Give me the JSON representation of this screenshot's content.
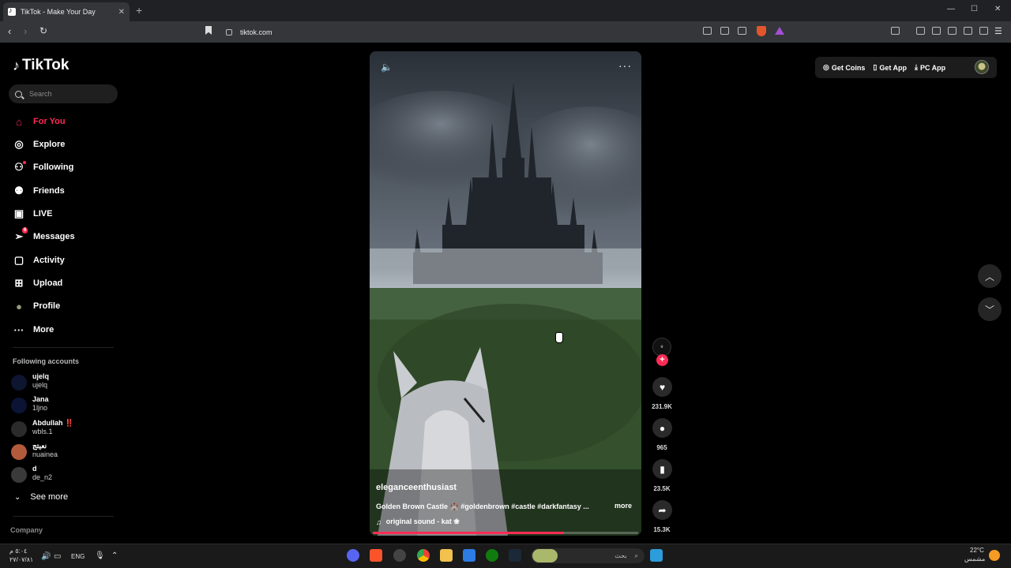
{
  "browser": {
    "tab_title": "TikTok - Make Your Day",
    "tab_close": "✕",
    "new_tab": "+",
    "url": "tiktok.com",
    "win_min": "—",
    "win_max": "☐",
    "win_close": "✕"
  },
  "sidebar": {
    "logo": "TikTok",
    "search_placeholder": "Search",
    "nav": [
      {
        "label": "For You",
        "icon": "home-icon",
        "glyph": "⌂"
      },
      {
        "label": "Explore",
        "icon": "compass-icon",
        "glyph": "◎"
      },
      {
        "label": "Following",
        "icon": "following-icon",
        "glyph": "⚇"
      },
      {
        "label": "Friends",
        "icon": "friends-icon",
        "glyph": "⚉"
      },
      {
        "label": "LIVE",
        "icon": "live-icon",
        "glyph": "▣"
      },
      {
        "label": "Messages",
        "icon": "messages-icon",
        "glyph": "➢",
        "badge": "6"
      },
      {
        "label": "Activity",
        "icon": "activity-icon",
        "glyph": "▢"
      },
      {
        "label": "Upload",
        "icon": "upload-icon",
        "glyph": "⊞"
      },
      {
        "label": "Profile",
        "icon": "profile-icon",
        "glyph": "●"
      },
      {
        "label": "More",
        "icon": "more-icon",
        "glyph": "···"
      }
    ],
    "following_title": "Following accounts",
    "accounts": [
      {
        "name": "ujelq",
        "handle": "ujelq"
      },
      {
        "name": "Jana",
        "handle": "1ljno"
      },
      {
        "name": "Abdullah ‼️",
        "handle": "wbls.1"
      },
      {
        "name": "نعيتج",
        "handle": "nuainea"
      },
      {
        "name": "d",
        "handle": "de_n2"
      }
    ],
    "see_more": "See more",
    "company": "Company"
  },
  "video": {
    "username": "eleganceenthusiast",
    "description": "Golden Brown Castle 🏰 #goldenbrown #castle #darkfantasy ...",
    "description_more": "more",
    "sound": "original sound - kat ❀",
    "progress": 0.72,
    "mute_glyph": "🔈",
    "more_glyph": "···"
  },
  "actions": {
    "likes": "231.9K",
    "comments": "965",
    "saves": "23.5K",
    "shares": "15.3K",
    "follow_plus": "+"
  },
  "header": {
    "get_coins": "Get Coins",
    "get_app": "Get App",
    "pc_app": "PC App"
  },
  "taskbar": {
    "time": "٥:٠٤ م",
    "date": "٢٧/٠٧/٨١",
    "lang": "ENG",
    "search_text": "بحث",
    "temp": "22°C",
    "weather": "مشمس"
  },
  "colors": {
    "accent": "#fe2c55",
    "background": "#000000"
  }
}
